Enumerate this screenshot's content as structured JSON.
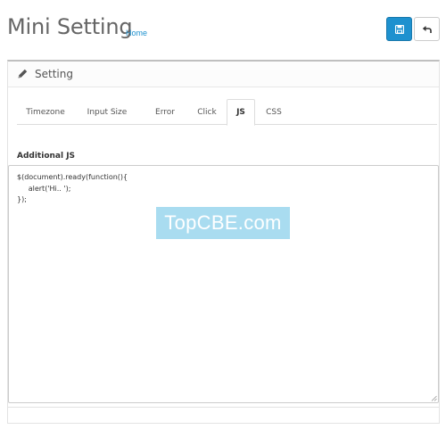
{
  "header": {
    "title": "Mini Setting",
    "breadcrumb": "Home",
    "save_icon": "floppy-disk-icon",
    "back_icon": "reply-arrow-icon"
  },
  "panel": {
    "title": "Setting",
    "title_icon": "pencil-icon"
  },
  "tabs": [
    {
      "label": "Timezone",
      "active": false
    },
    {
      "label": "Input Size",
      "active": false
    },
    {
      "label": "Error",
      "active": false
    },
    {
      "label": "Click",
      "active": false
    },
    {
      "label": "JS",
      "active": true
    },
    {
      "label": "CSS",
      "active": false
    }
  ],
  "js_field": {
    "label": "Additional JS",
    "value": "$(document).ready(function(){\n     alert('Hi.. ');\n});"
  },
  "watermark": "TopCBE.com",
  "colors": {
    "primary": "#1e91cf",
    "watermark_bg": "#a9dcf0"
  }
}
